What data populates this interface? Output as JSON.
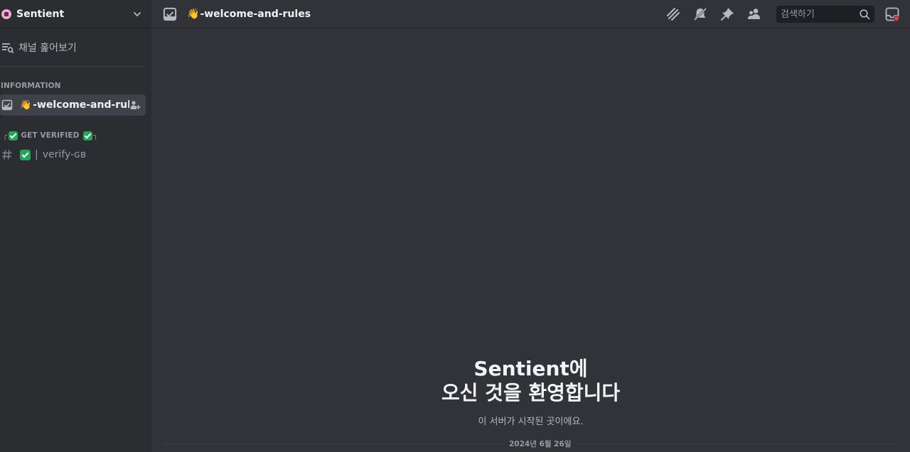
{
  "server": {
    "name": "Sentient"
  },
  "sidebar": {
    "browse_label": "채널 훑어보기",
    "categories": [
      {
        "label": "INFORMATION"
      },
      {
        "label": "GET VERIFIED",
        "prefix": "╭",
        "suffix": "╮"
      }
    ],
    "channels": [
      {
        "label": "-welcome-and-rul...",
        "emoji": "👋",
        "selected": true
      },
      {
        "label": "verify-ɢʙ",
        "separator": "|"
      }
    ]
  },
  "header": {
    "channel_title": "-welcome-and-rules",
    "channel_emoji": "👋",
    "search_placeholder": "검색하기",
    "icons": [
      "threads-icon",
      "mute-notifications-icon",
      "pin-icon",
      "members-icon",
      "search-icon",
      "inbox-icon"
    ]
  },
  "main": {
    "welcome_line1": "Sentient에",
    "welcome_line2": "오신 것을 환영합니다",
    "welcome_sub": "이 서버가 시작된 곳이에요.",
    "date_divider": "2024년 6월 26일"
  },
  "colors": {
    "background": "#313338",
    "sidebar": "#2b2d31",
    "selected": "#404249",
    "accent_green": "#23a55a",
    "notify_red": "#f23f43"
  }
}
